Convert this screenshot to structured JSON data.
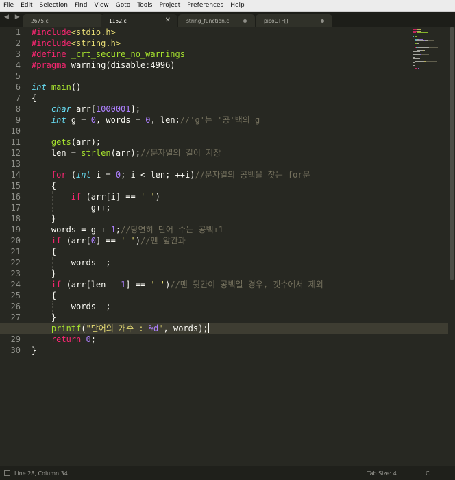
{
  "menu": [
    "File",
    "Edit",
    "Selection",
    "Find",
    "View",
    "Goto",
    "Tools",
    "Project",
    "Preferences",
    "Help"
  ],
  "nav_arrows": "◀ ▶",
  "tabs": [
    {
      "label": "2675.c",
      "active": false,
      "dirty": false
    },
    {
      "label": "1152.c",
      "active": true,
      "dirty": false
    },
    {
      "label": "string_function.c",
      "active": false,
      "dirty": true
    },
    {
      "label": "picoCTF[]",
      "active": false,
      "dirty": true
    }
  ],
  "current_line": 28,
  "code_lines": [
    [
      [
        "pp",
        "#include"
      ],
      [
        "str",
        "<stdio.h>"
      ]
    ],
    [
      [
        "pp",
        "#include"
      ],
      [
        "str",
        "<string.h>"
      ]
    ],
    [
      [
        "pp",
        "#define"
      ],
      [
        "pl",
        " "
      ],
      [
        "fn",
        "_crt_secure_no_warnings"
      ]
    ],
    [
      [
        "pp",
        "#pragma"
      ],
      [
        "pl",
        " warning(disable:4996)"
      ]
    ],
    [],
    [
      [
        "ty",
        "int"
      ],
      [
        "pl",
        " "
      ],
      [
        "fn",
        "main"
      ],
      [
        "pl",
        "()"
      ]
    ],
    [
      [
        "pl",
        "{"
      ]
    ],
    [
      [
        "pl",
        "    "
      ],
      [
        "ty",
        "char"
      ],
      [
        "pl",
        " arr["
      ],
      [
        "num",
        "1000001"
      ],
      [
        "pl",
        "];"
      ]
    ],
    [
      [
        "pl",
        "    "
      ],
      [
        "ty",
        "int"
      ],
      [
        "pl",
        " g = "
      ],
      [
        "num",
        "0"
      ],
      [
        "pl",
        ", words = "
      ],
      [
        "num",
        "0"
      ],
      [
        "pl",
        ", len;"
      ],
      [
        "cm",
        "//'g'는 '공'백의 g"
      ]
    ],
    [],
    [
      [
        "pl",
        "    "
      ],
      [
        "fn",
        "gets"
      ],
      [
        "pl",
        "(arr);"
      ]
    ],
    [
      [
        "pl",
        "    len = "
      ],
      [
        "fn",
        "strlen"
      ],
      [
        "pl",
        "(arr);"
      ],
      [
        "cm",
        "//문자열의 길이 저장"
      ]
    ],
    [],
    [
      [
        "pl",
        "    "
      ],
      [
        "kw",
        "for"
      ],
      [
        "pl",
        " ("
      ],
      [
        "ty",
        "int"
      ],
      [
        "pl",
        " i = "
      ],
      [
        "num",
        "0"
      ],
      [
        "pl",
        "; i < len; ++i)"
      ],
      [
        "cm",
        "//문자열의 공백을 찾는 for문"
      ]
    ],
    [
      [
        "pl",
        "    {"
      ]
    ],
    [
      [
        "pl",
        "        "
      ],
      [
        "kw",
        "if"
      ],
      [
        "pl",
        " (arr[i] == "
      ],
      [
        "str",
        "' '"
      ],
      [
        "pl",
        ")"
      ]
    ],
    [
      [
        "pl",
        "            g++;"
      ]
    ],
    [
      [
        "pl",
        "    }"
      ]
    ],
    [
      [
        "pl",
        "    words = g + "
      ],
      [
        "num",
        "1"
      ],
      [
        "pl",
        ";"
      ],
      [
        "cm",
        "//당연히 단어 수는 공백+1"
      ]
    ],
    [
      [
        "pl",
        "    "
      ],
      [
        "kw",
        "if"
      ],
      [
        "pl",
        " (arr["
      ],
      [
        "num",
        "0"
      ],
      [
        "pl",
        "] == "
      ],
      [
        "str",
        "' '"
      ],
      [
        "pl",
        ")"
      ],
      [
        "cm",
        "//맨 앞칸과"
      ]
    ],
    [
      [
        "pl",
        "    {"
      ]
    ],
    [
      [
        "pl",
        "        words--;"
      ]
    ],
    [
      [
        "pl",
        "    }"
      ]
    ],
    [
      [
        "pl",
        "    "
      ],
      [
        "kw",
        "if"
      ],
      [
        "pl",
        " (arr[len - "
      ],
      [
        "num",
        "1"
      ],
      [
        "pl",
        "] == "
      ],
      [
        "str",
        "' '"
      ],
      [
        "pl",
        ")"
      ],
      [
        "cm",
        "//맨 뒷칸이 공백일 경우, 갯수에서 제외"
      ]
    ],
    [
      [
        "pl",
        "    {"
      ]
    ],
    [
      [
        "pl",
        "        words--;"
      ]
    ],
    [
      [
        "pl",
        "    }"
      ]
    ],
    [
      [
        "pl",
        "    "
      ],
      [
        "fn",
        "printf"
      ],
      [
        "pl",
        "("
      ],
      [
        "str",
        "\"단어의 개수 : "
      ],
      [
        "fs",
        "%d"
      ],
      [
        "str",
        "\""
      ],
      [
        "pl",
        ", words);"
      ]
    ],
    [
      [
        "pl",
        "    "
      ],
      [
        "kw",
        "return"
      ],
      [
        "pl",
        " "
      ],
      [
        "num",
        "0"
      ],
      [
        "pl",
        ";"
      ]
    ],
    [
      [
        "pl",
        "}"
      ]
    ]
  ],
  "status": {
    "position": "Line 28, Column 34",
    "tab_size": "Tab Size: 4",
    "syntax": "C"
  },
  "colors": {
    "background": "#272822",
    "keyword": "#f92672",
    "type": "#66d9ef",
    "function": "#a6e22e",
    "number": "#ae81ff",
    "string": "#e6db74",
    "comment": "#75715e"
  }
}
